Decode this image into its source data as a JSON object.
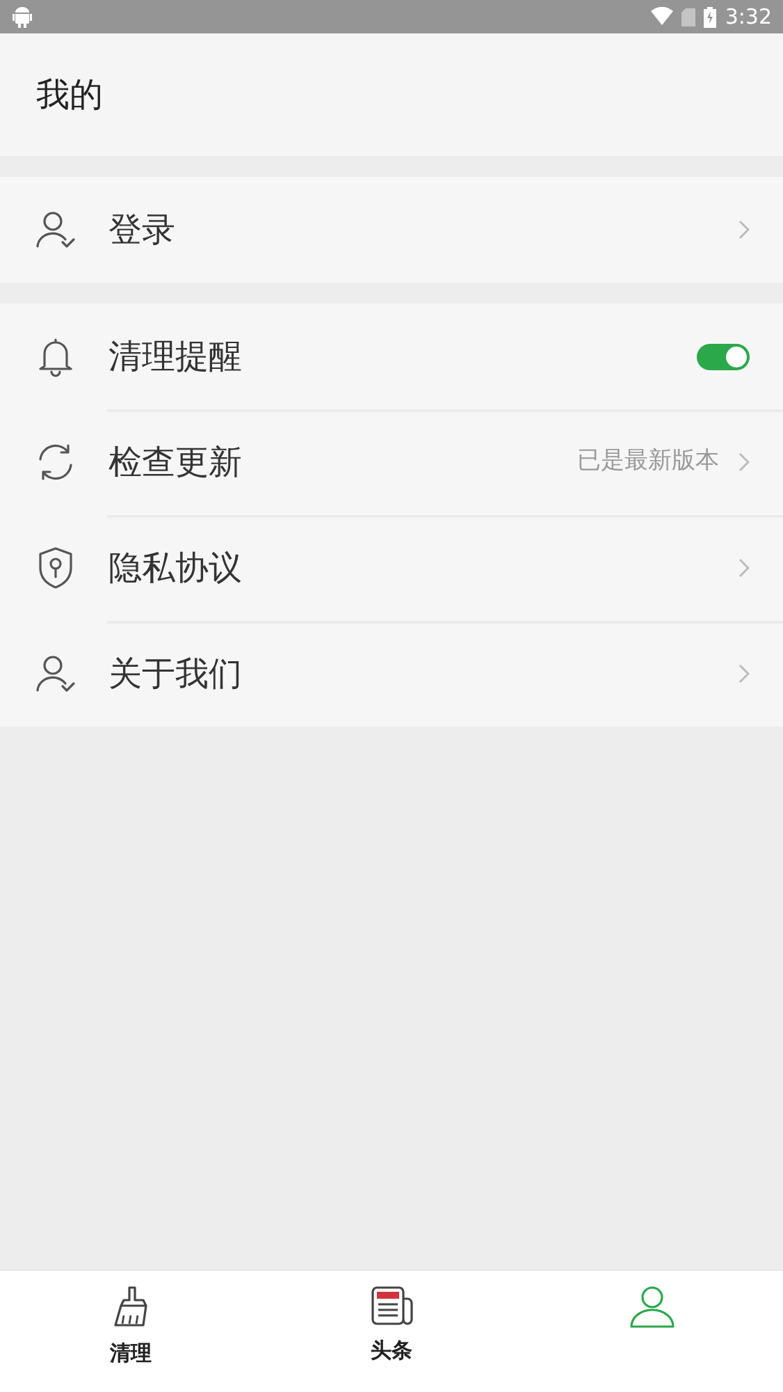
{
  "status_bar": {
    "time": "3:32"
  },
  "header": {
    "title": "我的"
  },
  "sections": [
    {
      "items": [
        {
          "kind": "link",
          "label": "登录"
        }
      ]
    },
    {
      "items": [
        {
          "kind": "toggle",
          "label": "清理提醒",
          "on": true
        },
        {
          "kind": "link",
          "label": "检查更新",
          "value": "已是最新版本"
        },
        {
          "kind": "link",
          "label": "隐私协议"
        },
        {
          "kind": "link",
          "label": "关于我们"
        }
      ]
    }
  ],
  "tab_bar": {
    "tabs": [
      {
        "label": "清理",
        "selected": false
      },
      {
        "label": "头条",
        "selected": false
      },
      {
        "selected": true
      }
    ]
  }
}
